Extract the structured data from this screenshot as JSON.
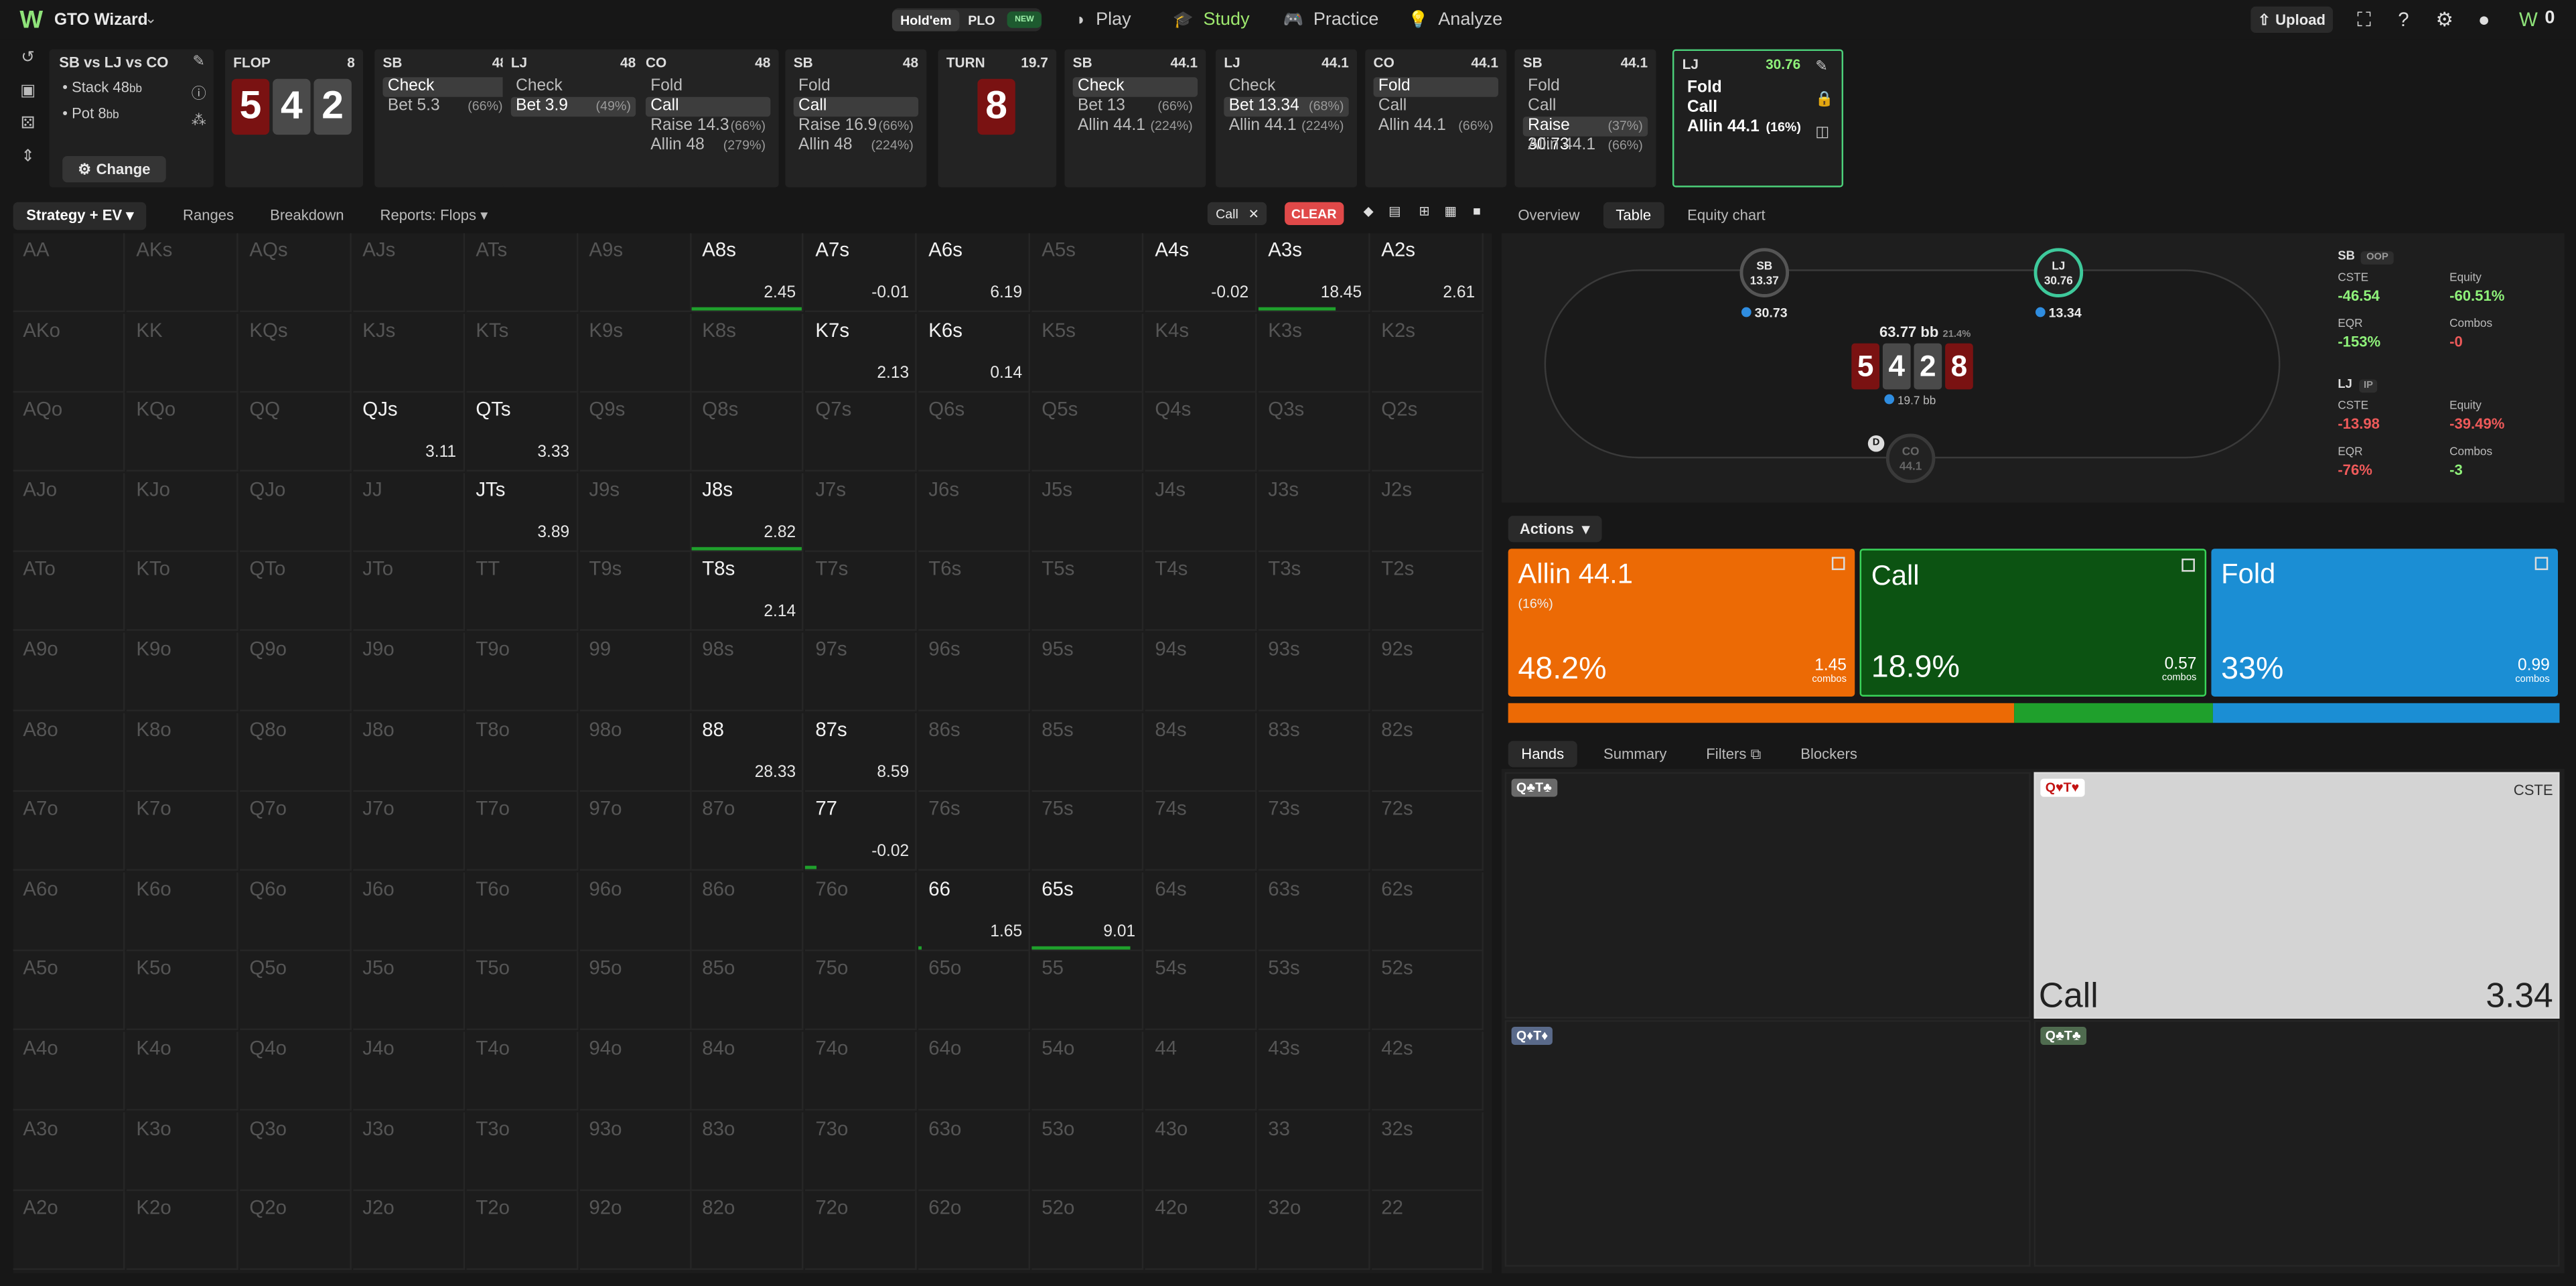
{
  "topbar": {
    "logo": "W",
    "brand": "GTO Wizard",
    "mode_holdem": "Hold'em",
    "mode_plo": "PLO",
    "new_tag": "NEW",
    "nav": [
      {
        "label": "Play",
        "icon": "play-icon"
      },
      {
        "label": "Study",
        "icon": "study-icon"
      },
      {
        "label": "Practice",
        "icon": "practice-icon"
      },
      {
        "label": "Analyze",
        "icon": "analyze-icon"
      }
    ],
    "upload": "Upload"
  },
  "spot": {
    "title": "SB vs LJ vs CO",
    "stack": "Stack 48",
    "stack_unit": "bb",
    "pot": "Pot 8",
    "pot_unit": "bb",
    "change": "Change"
  },
  "flop": {
    "label": "FLOP",
    "value": "8",
    "cards": [
      {
        "r": "5",
        "c": "red"
      },
      {
        "r": "4",
        "c": "gray"
      },
      {
        "r": "2",
        "c": "gray"
      }
    ]
  },
  "columns": [
    {
      "pos": "SB",
      "val": "48",
      "actions": [
        {
          "n": "Check",
          "p": "",
          "sel": true
        },
        {
          "n": "Bet 5.3",
          "p": "(66%)",
          "sel": false
        }
      ]
    },
    {
      "pos": "LJ",
      "val": "48",
      "actions": [
        {
          "n": "Check",
          "p": "",
          "sel": false
        },
        {
          "n": "Bet 3.9",
          "p": "(49%)",
          "sel": true
        }
      ]
    },
    {
      "pos": "CO",
      "val": "48",
      "actions": [
        {
          "n": "Fold",
          "p": "",
          "sel": false
        },
        {
          "n": "Call",
          "p": "",
          "sel": true
        },
        {
          "n": "Raise 14.3",
          "p": "(66%)",
          "sel": false
        },
        {
          "n": "Allin 48",
          "p": "(279%)",
          "sel": false
        }
      ]
    },
    {
      "pos": "SB",
      "val": "48",
      "actions": [
        {
          "n": "Fold",
          "p": "",
          "sel": false
        },
        {
          "n": "Call",
          "p": "",
          "sel": true
        },
        {
          "n": "Raise 16.9",
          "p": "(66%)",
          "sel": false
        },
        {
          "n": "Allin 48",
          "p": "(224%)",
          "sel": false
        }
      ]
    }
  ],
  "turn": {
    "label": "TURN",
    "value": "19.7",
    "card": "8"
  },
  "columns2": [
    {
      "pos": "SB",
      "val": "44.1",
      "actions": [
        {
          "n": "Check",
          "p": "",
          "sel": true
        },
        {
          "n": "Bet 13",
          "p": "(66%)",
          "sel": false
        },
        {
          "n": "Allin 44.1",
          "p": "(224%)",
          "sel": false
        }
      ]
    },
    {
      "pos": "LJ",
      "val": "44.1",
      "actions": [
        {
          "n": "Check",
          "p": "",
          "sel": false
        },
        {
          "n": "Bet 13.34",
          "p": "(68%)",
          "sel": true
        },
        {
          "n": "Allin 44.1",
          "p": "(224%)",
          "sel": false
        }
      ]
    },
    {
      "pos": "CO",
      "val": "44.1",
      "actions": [
        {
          "n": "Fold",
          "p": "",
          "sel": true
        },
        {
          "n": "Call",
          "p": "",
          "sel": false
        },
        {
          "n": "Allin 44.1",
          "p": "(66%)",
          "sel": false
        }
      ]
    },
    {
      "pos": "SB",
      "val": "44.1",
      "actions": [
        {
          "n": "Fold",
          "p": "",
          "sel": false
        },
        {
          "n": "Call",
          "p": "",
          "sel": false
        },
        {
          "n": "Raise 30.73",
          "p": "(37%)",
          "sel": true
        },
        {
          "n": "Allin 44.1",
          "p": "(66%)",
          "sel": false
        }
      ]
    }
  ],
  "active_col": {
    "pos": "LJ",
    "val": "30.76",
    "actions": [
      {
        "n": "Fold",
        "p": ""
      },
      {
        "n": "Call",
        "p": ""
      },
      {
        "n": "Allin 44.1",
        "p": "(16%)"
      }
    ]
  },
  "left_tabs": {
    "strategy": "Strategy + EV",
    "ranges": "Ranges",
    "breakdown": "Breakdown",
    "reports": "Reports: Flops",
    "chip": "Call",
    "clear": "CLEAR"
  },
  "grid_hands": [
    [
      "AA",
      "AKs",
      "AQs",
      "AJs",
      "ATs",
      "A9s",
      "A8s",
      "A7s",
      "A6s",
      "A5s",
      "A4s",
      "A3s",
      "A2s"
    ],
    [
      "AKo",
      "KK",
      "KQs",
      "KJs",
      "KTs",
      "K9s",
      "K8s",
      "K7s",
      "K6s",
      "K5s",
      "K4s",
      "K3s",
      "K2s"
    ],
    [
      "AQo",
      "KQo",
      "QQ",
      "QJs",
      "QTs",
      "Q9s",
      "Q8s",
      "Q7s",
      "Q6s",
      "Q5s",
      "Q4s",
      "Q3s",
      "Q2s"
    ],
    [
      "AJo",
      "KJo",
      "QJo",
      "JJ",
      "JTs",
      "J9s",
      "J8s",
      "J7s",
      "J6s",
      "J5s",
      "J4s",
      "J3s",
      "J2s"
    ],
    [
      "ATo",
      "KTo",
      "QTo",
      "JTo",
      "TT",
      "T9s",
      "T8s",
      "T7s",
      "T6s",
      "T5s",
      "T4s",
      "T3s",
      "T2s"
    ],
    [
      "A9o",
      "K9o",
      "Q9o",
      "J9o",
      "T9o",
      "99",
      "98s",
      "97s",
      "96s",
      "95s",
      "94s",
      "93s",
      "92s"
    ],
    [
      "A8o",
      "K8o",
      "Q8o",
      "J8o",
      "T8o",
      "98o",
      "88",
      "87s",
      "86s",
      "85s",
      "84s",
      "83s",
      "82s"
    ],
    [
      "A7o",
      "K7o",
      "Q7o",
      "J7o",
      "T7o",
      "97o",
      "87o",
      "77",
      "76s",
      "75s",
      "74s",
      "73s",
      "72s"
    ],
    [
      "A6o",
      "K6o",
      "Q6o",
      "J6o",
      "T6o",
      "96o",
      "86o",
      "76o",
      "66",
      "65s",
      "64s",
      "63s",
      "62s"
    ],
    [
      "A5o",
      "K5o",
      "Q5o",
      "J5o",
      "T5o",
      "95o",
      "85o",
      "75o",
      "65o",
      "55",
      "54s",
      "53s",
      "52s"
    ],
    [
      "A4o",
      "K4o",
      "Q4o",
      "J4o",
      "T4o",
      "94o",
      "84o",
      "74o",
      "64o",
      "54o",
      "44",
      "43s",
      "42s"
    ],
    [
      "A3o",
      "K3o",
      "Q3o",
      "J3o",
      "T3o",
      "93o",
      "83o",
      "73o",
      "63o",
      "53o",
      "43o",
      "33",
      "32s"
    ],
    [
      "A2o",
      "K2o",
      "Q2o",
      "J2o",
      "T2o",
      "92o",
      "82o",
      "72o",
      "62o",
      "52o",
      "42o",
      "32o",
      "22"
    ]
  ],
  "grid_active": [
    {
      "r": 0,
      "c": 6,
      "ev": "2.45",
      "bar": 1.0
    },
    {
      "r": 0,
      "c": 7,
      "ev": "-0.01",
      "bar": 0
    },
    {
      "r": 0,
      "c": 8,
      "ev": "6.19",
      "bar": 0
    },
    {
      "r": 0,
      "c": 10,
      "ev": "-0.02",
      "bar": 0
    },
    {
      "r": 0,
      "c": 11,
      "ev": "18.45",
      "bar": 0.7
    },
    {
      "r": 0,
      "c": 12,
      "ev": "2.61",
      "bar": 0
    },
    {
      "r": 1,
      "c": 7,
      "ev": "2.13",
      "bar": 0
    },
    {
      "r": 1,
      "c": 8,
      "ev": "0.14",
      "bar": 0
    },
    {
      "r": 2,
      "c": 3,
      "ev": "3.11",
      "bar": 0
    },
    {
      "r": 2,
      "c": 4,
      "ev": "3.33",
      "bar": 0
    },
    {
      "r": 3,
      "c": 4,
      "ev": "3.89",
      "bar": 0
    },
    {
      "r": 3,
      "c": 6,
      "ev": "2.82",
      "bar": 1.0
    },
    {
      "r": 4,
      "c": 6,
      "ev": "2.14",
      "bar": 0
    },
    {
      "r": 6,
      "c": 6,
      "ev": "28.33",
      "bar": 0
    },
    {
      "r": 6,
      "c": 7,
      "ev": "8.59",
      "bar": 0
    },
    {
      "r": 7,
      "c": 7,
      "ev": "-0.02",
      "bar": 0.1
    },
    {
      "r": 8,
      "c": 8,
      "ev": "1.65",
      "bar": 0.02
    },
    {
      "r": 8,
      "c": 9,
      "ev": "9.01",
      "bar": 0.9
    }
  ],
  "right_tabs": {
    "overview": "Overview",
    "table": "Table",
    "equity": "Equity chart"
  },
  "table": {
    "sb": {
      "name": "SB",
      "stack": "13.37",
      "bet": "30.73"
    },
    "lj": {
      "name": "LJ",
      "stack": "30.76",
      "bet": "13.34"
    },
    "co": {
      "name": "CO",
      "stack": "44.1"
    },
    "dealer": "D",
    "pot": "63.77 bb",
    "pot_pct": "21.4%",
    "pot_bet": "19.7 bb",
    "board": [
      {
        "r": "5",
        "c": "red"
      },
      {
        "r": "4",
        "c": "gray"
      },
      {
        "r": "2",
        "c": "gray"
      },
      {
        "r": "8",
        "c": "red"
      }
    ]
  },
  "stats": {
    "sb_label": "SB",
    "sb_tag": "OOP",
    "lj_label": "LJ",
    "lj_tag": "IP",
    "sb": [
      {
        "k": "CSTE",
        "v": "-46.54",
        "col": "#8ff27a"
      },
      {
        "k": "Equity",
        "v": "-60.51%",
        "col": "#8ff27a"
      },
      {
        "k": "EQR",
        "v": "-153%",
        "col": "#8ff27a"
      },
      {
        "k": "Combos",
        "v": "-0",
        "col": "#ef5a5a"
      }
    ],
    "lj": [
      {
        "k": "CSTE",
        "v": "-13.98",
        "col": "#ef5a5a"
      },
      {
        "k": "Equity",
        "v": "-39.49%",
        "col": "#ef5a5a"
      },
      {
        "k": "EQR",
        "v": "-76%",
        "col": "#ef5a5a"
      },
      {
        "k": "Combos",
        "v": "-3",
        "col": "#8ff27a"
      }
    ]
  },
  "actions": {
    "label": "Actions",
    "items": [
      {
        "name": "Allin 44.1",
        "pct_label": "(16%)",
        "freq": "48.2%",
        "combos": "1.45",
        "combos_label": "combos",
        "color": "#ec6a05",
        "frac": 0.482
      },
      {
        "name": "Call",
        "pct_label": "",
        "freq": "18.9%",
        "combos": "0.57",
        "combos_label": "combos",
        "color": "#0c5312",
        "frac": 0.189
      },
      {
        "name": "Fold",
        "pct_label": "",
        "freq": "33%",
        "combos": "0.99",
        "combos_label": "combos",
        "color": "#1b8ed4",
        "frac": 0.33
      }
    ]
  },
  "hands_tabs": {
    "hands": "Hands",
    "summary": "Summary",
    "filters": "Filters",
    "blockers": "Blockers"
  },
  "hand_cards": [
    {
      "label": "Q♣T♣",
      "action": "",
      "ev": ""
    },
    {
      "label": "Q♥T♥",
      "action": "Call",
      "ev": "3.34",
      "metric": "CSTE"
    },
    {
      "label": "Q♦T♦",
      "action": "",
      "ev": ""
    },
    {
      "label": "Q♣T♣",
      "action": "",
      "ev": ""
    }
  ]
}
